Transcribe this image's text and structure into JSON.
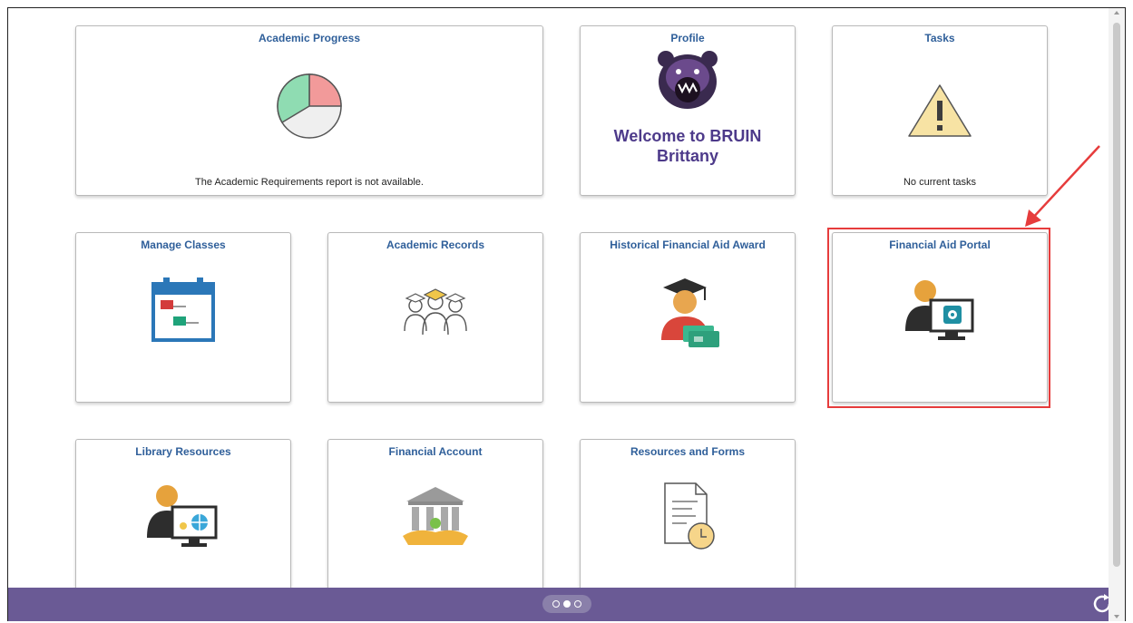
{
  "tiles": {
    "academic_progress": {
      "title": "Academic Progress",
      "footer": "The Academic Requirements report is not available."
    },
    "profile": {
      "title": "Profile",
      "welcome_line1": "Welcome to BRUIN",
      "welcome_line2": "Brittany"
    },
    "tasks": {
      "title": "Tasks",
      "footer": "No current tasks"
    },
    "manage_classes": {
      "title": "Manage Classes"
    },
    "academic_records": {
      "title": "Academic Records"
    },
    "historical_financial_aid": {
      "title": "Historical Financial Aid Award"
    },
    "financial_aid_portal": {
      "title": "Financial Aid Portal"
    },
    "library_resources": {
      "title": "Library Resources"
    },
    "financial_account": {
      "title": "Financial Account"
    },
    "resources_and_forms": {
      "title": "Resources and Forms"
    }
  },
  "pagination": {
    "pages": 3,
    "active_page": 2
  },
  "colors": {
    "title_blue": "#2f5f9a",
    "welcome_purple": "#4d3a8a",
    "bottom_bar": "#6a5a95",
    "highlight_red": "#e63c3c"
  },
  "icons": {
    "academic_progress": "pie-chart-icon",
    "profile": "bear-mascot-icon",
    "tasks": "warning-icon",
    "manage_classes": "calendar-icon",
    "academic_records": "graduates-icon",
    "historical_financial_aid": "graduate-money-icon",
    "financial_aid_portal": "person-monitor-icon",
    "library_resources": "person-monitor-globe-icon",
    "financial_account": "bank-icon",
    "resources_and_forms": "document-clock-icon",
    "refresh": "refresh-icon"
  }
}
